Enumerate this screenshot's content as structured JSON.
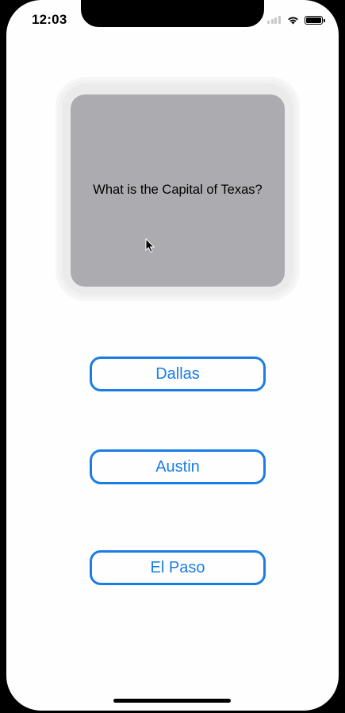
{
  "status_bar": {
    "time": "12:03",
    "icons": [
      "cellular-signal-icon",
      "wifi-icon",
      "battery-icon"
    ]
  },
  "card": {
    "question": "What is the Capital of Texas?"
  },
  "answers": [
    {
      "label": "Dallas"
    },
    {
      "label": "Austin"
    },
    {
      "label": "El Paso"
    }
  ],
  "colors": {
    "accent": "#1a7de5",
    "card_background": "#acabaf",
    "screen_background": "#fefefe"
  }
}
